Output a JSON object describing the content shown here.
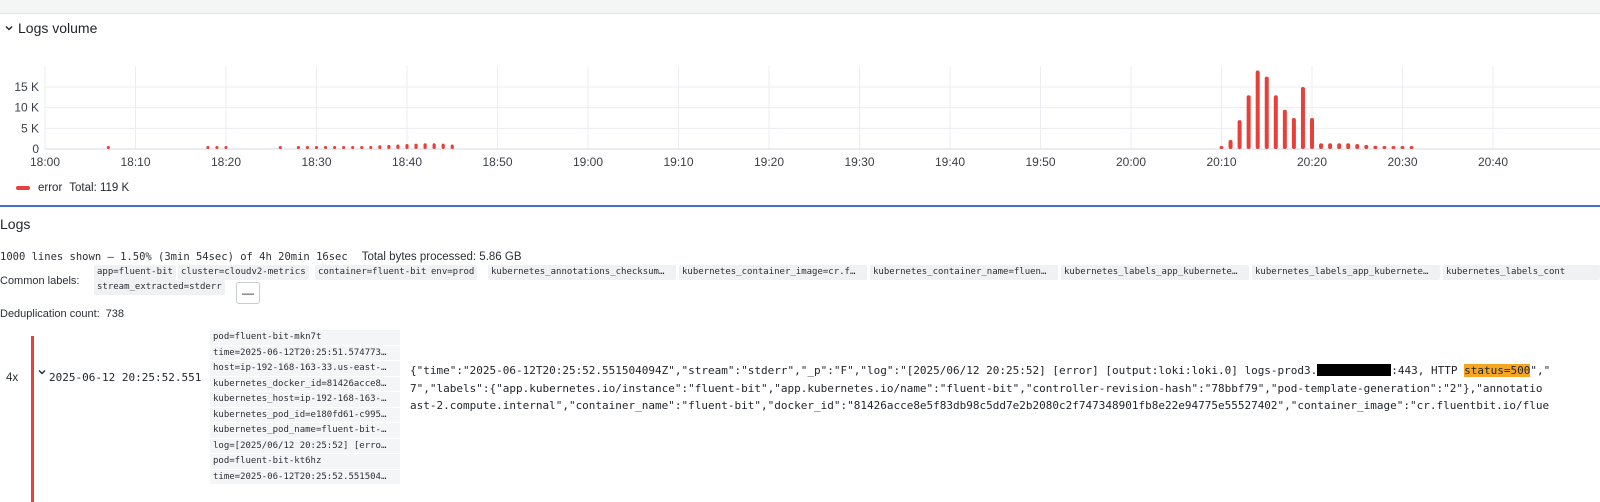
{
  "logs_volume": {
    "title": "Logs volume",
    "legend": {
      "series_name": "error",
      "total": "Total: 119 K"
    }
  },
  "chart_data": {
    "type": "bar",
    "series": [
      {
        "name": "error",
        "color": "#e5403a"
      }
    ],
    "ylim": [
      0,
      20000
    ],
    "y_ticks": [
      "0",
      "5 K",
      "10 K",
      "15 K"
    ],
    "x_ticks": [
      "18:00",
      "18:10",
      "18:20",
      "18:30",
      "18:40",
      "18:50",
      "19:00",
      "19:10",
      "19:20",
      "19:30",
      "19:40",
      "19:50",
      "20:00",
      "20:10",
      "20:20",
      "20:30",
      "20:40"
    ],
    "x_minutes": [
      7,
      18,
      19,
      20,
      26,
      28,
      29,
      30,
      31,
      32,
      33,
      34,
      35,
      36,
      37,
      38,
      39,
      40,
      41,
      42,
      43,
      44,
      45,
      70,
      71,
      72,
      73,
      74,
      75,
      76,
      77,
      78,
      79,
      80,
      81,
      82,
      83,
      84,
      85,
      86,
      87,
      88,
      89,
      90,
      91,
      92,
      93,
      94,
      95
    ],
    "bar_minutes": [
      130,
      131,
      132,
      133,
      134,
      135,
      136,
      137,
      138,
      139,
      140,
      141,
      142,
      143,
      144,
      145,
      146,
      147,
      148,
      149,
      150,
      151
    ],
    "bar_values": [
      400,
      2200,
      7000,
      13000,
      19000,
      17500,
      13000,
      9500,
      7500,
      15000,
      7500,
      1400,
      1400,
      1400,
      1400,
      1200,
      1000,
      800,
      600,
      500,
      400,
      300
    ],
    "dot_minutes": [
      7,
      18,
      19,
      20,
      26,
      28,
      29,
      30,
      31,
      32,
      33,
      34,
      35,
      36,
      37,
      38,
      39,
      40,
      41,
      42,
      43,
      44,
      45
    ],
    "dot_values": [
      200,
      200,
      200,
      200,
      200,
      200,
      200,
      200,
      200,
      200,
      200,
      200,
      200,
      500,
      900,
      1000,
      1100,
      1200,
      1300,
      1400,
      1400,
      1300,
      1100
    ]
  },
  "logs": {
    "title": "Logs",
    "lines_shown": "1000 lines shown — 1.50% (3min 54sec) of 4h 20min 16sec",
    "bytes_processed": "Total bytes processed:  5.86 GB",
    "common_labels_label": "Common labels:",
    "common_labels": [
      "app=fluent-bit",
      "cluster=cloudv2-metrics",
      "container=fluent-bit",
      "env=prod",
      "kubernetes_annotations_checksum…",
      "kubernetes_container_image=cr.f…",
      "kubernetes_container_name=fluen…",
      "kubernetes_labels_app_kubernete…",
      "kubernetes_labels_app_kubernete…",
      "kubernetes_labels_cont",
      "stream_extracted=stderr"
    ],
    "collapse_label": "—",
    "dedup_label": "Deduplication count:",
    "dedup_value": "738"
  },
  "log_row": {
    "count": "4x",
    "timestamp": "2025-06-12 20:25:52.551",
    "fields": [
      "pod=fluent-bit-mkn7t",
      "time=2025-06-12T20:25:51.574773…",
      "host=ip-192-168-163-33.us-east-…",
      "kubernetes_docker_id=81426acce8…",
      "kubernetes_host=ip-192-168-163-…",
      "kubernetes_pod_id=e180fd61-c995…",
      "kubernetes_pod_name=fluent-bit-…",
      "log=[2025/06/12 20:25:52] [erro…",
      "pod=fluent-bit-kt6hz",
      "time=2025-06-12T20:25:52.551504…"
    ],
    "line1_a": "{\"time\":\"2025-06-12T20:25:52.551504094Z\",\"stream\":\"stderr\",\"_p\":\"F\",\"log\":\"[2025/06/12 20:25:52] [error] [output:loki:loki.0] logs-prod3.",
    "line1_b": ":443, HTTP ",
    "line1_hl": "status=500",
    "line1_c": "\",\"",
    "line2": "7\",\"labels\":{\"app.kubernetes.io/instance\":\"fluent-bit\",\"app.kubernetes.io/name\":\"fluent-bit\",\"controller-revision-hash\":\"78bbf79\",\"pod-template-generation\":\"2\"},\"annotatio",
    "line3": "ast-2.compute.internal\",\"container_name\":\"fluent-bit\",\"docker_id\":\"81426acce8e5f83db98c5dd7e2b2080c2f747348901fb8e22e94775e55527402\",\"container_image\":\"cr.fluentbit.io/flue"
  }
}
